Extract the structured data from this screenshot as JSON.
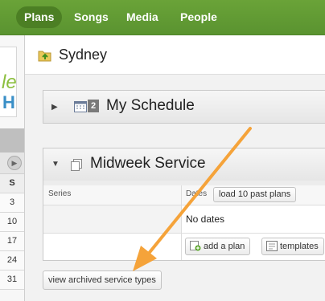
{
  "nav": {
    "tabs": [
      {
        "label": "Plans",
        "active": true
      },
      {
        "label": "Songs"
      },
      {
        "label": "Media"
      },
      {
        "label": "People"
      }
    ]
  },
  "left": {
    "logo_letters": [
      "le",
      "H"
    ],
    "calendar_day_header": "S",
    "calendar_days": [
      "3",
      "10",
      "17",
      "24",
      "31"
    ]
  },
  "header": {
    "title": "Sydney"
  },
  "panels": [
    {
      "title": "My Schedule",
      "badge": "2",
      "expanded": false
    },
    {
      "title": "Midweek Service",
      "expanded": true,
      "columns": {
        "series": "Series",
        "dates": "Dates"
      },
      "load_past_label": "load 10 past plans",
      "no_dates_label": "No dates",
      "add_plan_label": "add a plan",
      "templates_label": "templates"
    }
  ],
  "archived_button_label": "view archived service types",
  "colors": {
    "nav_green": "#6aa338",
    "arrow_orange": "#f5a33a"
  }
}
